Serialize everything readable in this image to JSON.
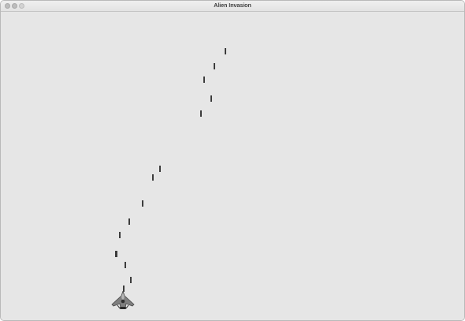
{
  "window": {
    "title": "Alien Invasion"
  },
  "game": {
    "background_color": "#e6e6e6",
    "bullet_color": "#3c3c3c",
    "bullets_in_flight": 15,
    "player": {
      "sprite": "spaceship-icon"
    }
  }
}
